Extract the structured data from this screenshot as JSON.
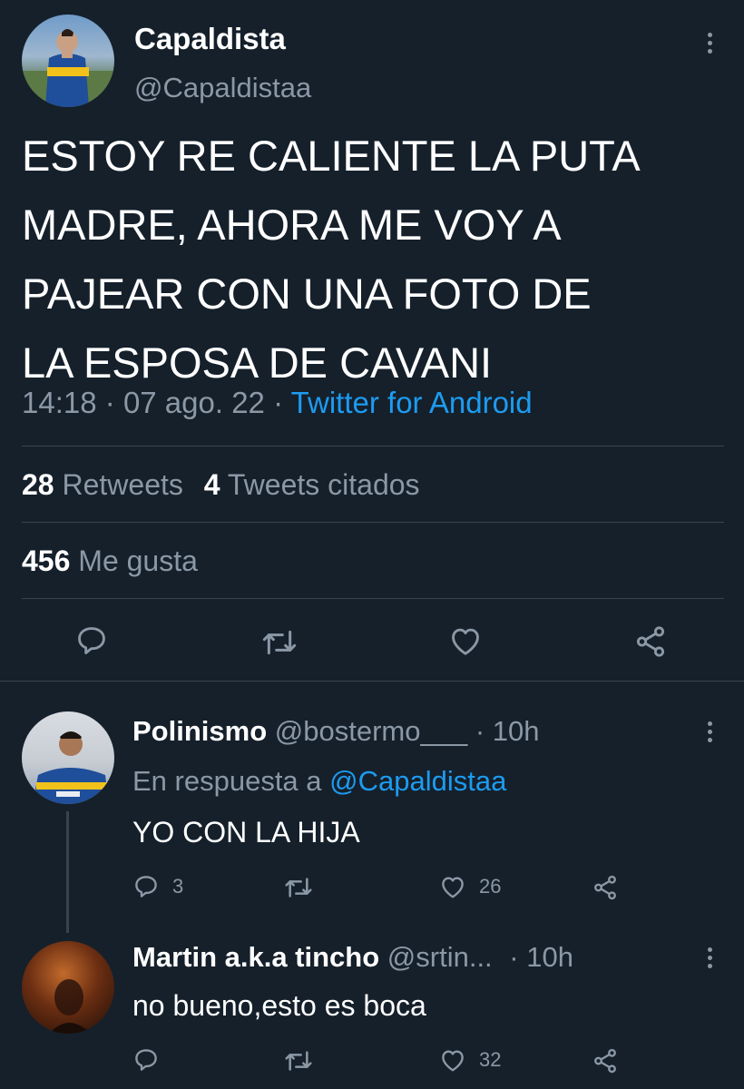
{
  "main_tweet": {
    "display_name": "Capaldista",
    "handle": "@Capaldistaa",
    "text_lines": [
      "ESTOY RE CALIENTE LA PUTA",
      "MADRE, AHORA ME VOY A",
      "PAJEAR CON UNA FOTO DE",
      "LA ESPOSA DE CAVANI"
    ],
    "time": "14:18",
    "date": "07 ago. 22",
    "source": "Twitter for Android",
    "separator": "·",
    "retweets_count": "28",
    "retweets_label": "Retweets",
    "quotes_count": "4",
    "quotes_label": "Tweets citados",
    "likes_count": "456",
    "likes_label": "Me gusta"
  },
  "replies": [
    {
      "display_name": "Polinismo",
      "handle": "@bostermo___",
      "age": "· 10h",
      "reply_prefix": "En respuesta a",
      "reply_to": "@Capaldistaa",
      "text": "YO CON LA HIJA",
      "reply_count": "3",
      "retweet_count": "",
      "like_count": "26"
    },
    {
      "display_name": "Martin a.k.a tincho",
      "handle": "@srtin...",
      "age": "· 10h",
      "text": "no bueno,esto es boca",
      "reply_count": "",
      "retweet_count": "",
      "like_count": "32"
    }
  ],
  "colors": {
    "background": "#15202b",
    "text": "#ffffff",
    "secondary": "#8b98a5",
    "accent": "#1d9bf0",
    "divider": "#38444d"
  },
  "icons": [
    "reply-icon",
    "retweet-icon",
    "like-icon",
    "share-icon",
    "more-icon"
  ]
}
